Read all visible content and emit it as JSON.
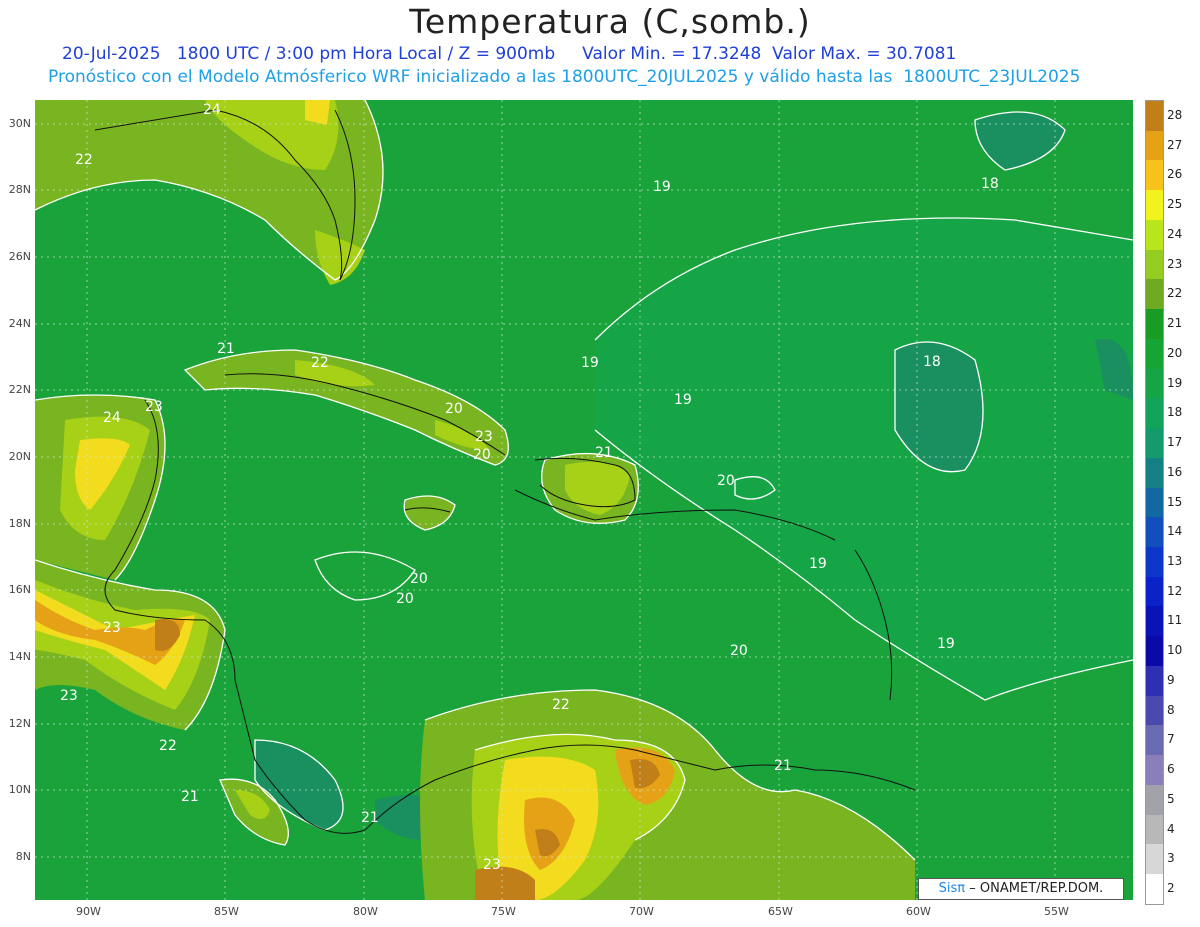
{
  "title": "Temperatura (C,somb.)",
  "subtitle_line1": "20-Jul-2025   1800 UTC / 3:00 pm Hora Local / Z = 900mb     Valor Min. = 17.3248  Valor Max. = 30.7081",
  "subtitle_line2": "Pronóstico con el Modelo Atmósferico WRF inicializado a las 1800UTC_20JUL2025 y válido hasta las  1800UTC_23JUL2025",
  "map": {
    "latitude_labels": [
      "30N",
      "28N",
      "26N",
      "24N",
      "22N",
      "20N",
      "18N",
      "16N",
      "14N",
      "12N",
      "10N",
      "8N"
    ],
    "longitude_labels": [
      "90W",
      "85W",
      "80W",
      "75W",
      "70W",
      "65W",
      "60W",
      "55W"
    ],
    "contour_labels": [
      "24",
      "22",
      "23",
      "24",
      "21",
      "22",
      "20",
      "23",
      "21",
      "20",
      "20",
      "20",
      "23",
      "23",
      "22",
      "21",
      "21",
      "23",
      "19",
      "18",
      "19",
      "18",
      "19",
      "19",
      "20",
      "19",
      "20",
      "21",
      "22"
    ],
    "field_colors": {
      "base": "#1aa33a",
      "cool": "#1a8f60",
      "warm_light": "#79b521",
      "warm": "#a7d117",
      "hot": "#f2dc1d",
      "hotter": "#e6a217",
      "hottest": "#c07f18"
    }
  },
  "colorbar": {
    "labels": [
      "28",
      "27",
      "26",
      "25",
      "24",
      "23",
      "22",
      "21",
      "20",
      "19",
      "18",
      "17",
      "16",
      "15",
      "14",
      "13",
      "12",
      "11",
      "10",
      "9",
      "8",
      "7",
      "6",
      "5",
      "4",
      "3",
      "2"
    ],
    "colors": [
      "#c07f18",
      "#e6a217",
      "#f7c21c",
      "#f2f21d",
      "#b9e51c",
      "#94cc21",
      "#6faa23",
      "#199c23",
      "#16a535",
      "#15a546",
      "#14a35b",
      "#149b6d",
      "#147f84",
      "#1268a3",
      "#104fbc",
      "#0d37c9",
      "#0b22c9",
      "#0a14b6",
      "#0a0aa9",
      "#2f2fb1",
      "#4a4aae",
      "#6a6ab2",
      "#8a7fba",
      "#a2a2aa",
      "#b8b8b8",
      "#d7d7d7",
      "#ffffff"
    ]
  },
  "credit": {
    "logo": "Sisπ",
    "text": "– ONAMET/REP.DOM."
  }
}
